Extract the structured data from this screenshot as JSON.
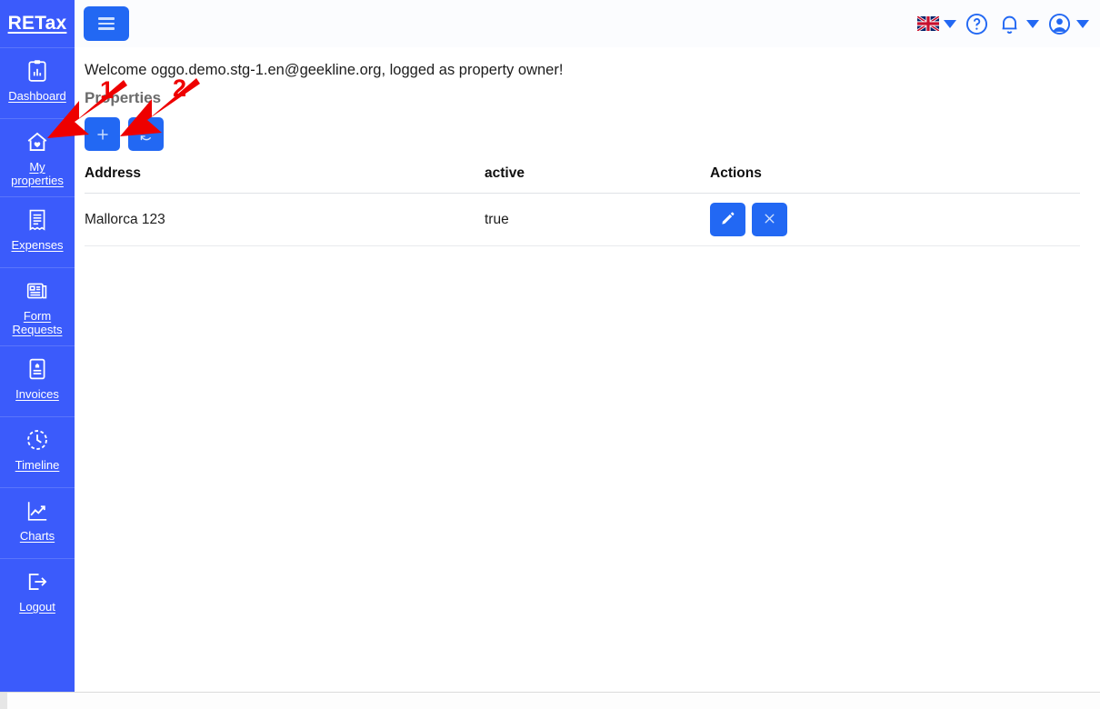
{
  "app": {
    "brand": "RETax",
    "accent_blue": "#2268f3",
    "sidebar_blue": "#3b5bfb",
    "annotation_red": "#ee0000"
  },
  "sidebar": {
    "items": [
      {
        "label": "Dashboard",
        "icon": "clipboard-chart-icon"
      },
      {
        "label": "My properties",
        "icon": "house-heart-icon"
      },
      {
        "label": "Expenses",
        "icon": "receipt-icon"
      },
      {
        "label": "Form Requests",
        "icon": "forms-icon"
      },
      {
        "label": "Invoices",
        "icon": "invoice-icon"
      },
      {
        "label": "Timeline",
        "icon": "clock-icon"
      },
      {
        "label": "Charts",
        "icon": "line-chart-icon"
      },
      {
        "label": "Logout",
        "icon": "logout-icon"
      }
    ]
  },
  "topbar": {
    "menu_toggle": "hamburger-icon",
    "language_flag": "uk-flag-icon",
    "help": "question-circle-icon",
    "notifications": "bell-icon",
    "account": "user-circle-icon"
  },
  "main": {
    "welcome": "Welcome oggo.demo.stg-1.en@geekline.org, logged as property owner!",
    "page_title": "Properties",
    "toolbar": {
      "add_label": "+",
      "add_name": "plus-icon",
      "refresh_name": "refresh-icon"
    },
    "table": {
      "columns": [
        "Address",
        "active",
        "Actions"
      ],
      "rows": [
        {
          "address": "Mallorca 123",
          "active": "true"
        }
      ],
      "row_actions": {
        "edit": "pencil-icon",
        "delete": "close-x-icon"
      }
    }
  },
  "annotations": [
    {
      "number": "1"
    },
    {
      "number": "2"
    }
  ]
}
